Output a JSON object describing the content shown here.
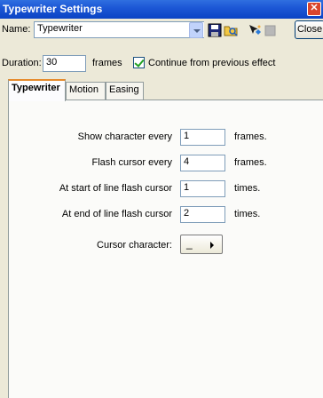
{
  "window": {
    "title": "Typewriter Settings"
  },
  "header": {
    "name_label": "Name:",
    "name_value": "Typewriter",
    "close_label": "Close"
  },
  "duration": {
    "label": "Duration:",
    "value": "30",
    "unit": "frames",
    "continue_label": "Continue from previous effect",
    "continue_checked": true
  },
  "tabs": [
    {
      "label": "Typewriter",
      "active": true
    },
    {
      "label": "Motion",
      "active": false
    },
    {
      "label": "Easing",
      "active": false
    }
  ],
  "settings": [
    {
      "label": "Show character every",
      "value": "1",
      "unit": "frames."
    },
    {
      "label": "Flash cursor every",
      "value": "4",
      "unit": "frames."
    },
    {
      "label": "At start of line flash cursor",
      "value": "1",
      "unit": "times."
    },
    {
      "label": "At end of line flash cursor",
      "value": "2",
      "unit": "times."
    }
  ],
  "cursor": {
    "label": "Cursor character:",
    "value": "_"
  },
  "icons": [
    "close-icon",
    "dropdown-arrow-icon",
    "save-icon",
    "open-folder-icon",
    "apply-effect-icon",
    "stop-icon",
    "checkmark-icon",
    "arrow-right-icon"
  ]
}
